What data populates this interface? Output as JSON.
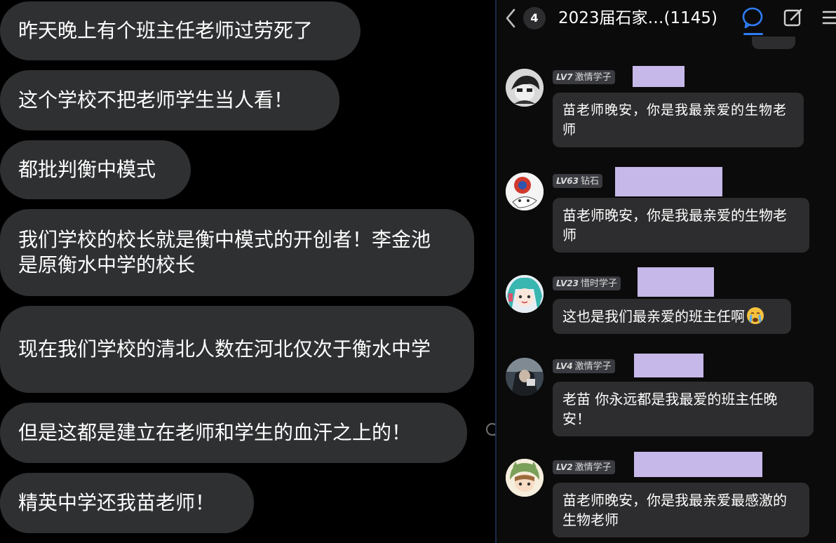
{
  "left_chat": {
    "messages": [
      {
        "text": "昨天晚上有个班主任老师过劳死了"
      },
      {
        "text": "这个学校不把老师学生当人看！"
      },
      {
        "text": "都批判衡中模式"
      },
      {
        "text": "我们学校的校长就是衡中模式的开创者！李金池是原衡水中学的校长"
      },
      {
        "text": "现在我们学校的清北人数在河北仅次于衡水中学"
      },
      {
        "text": "但是这都是建立在老师和学生的血汗之上的！"
      },
      {
        "text": "精英中学还我苗老师！"
      }
    ]
  },
  "right_chat": {
    "header": {
      "unread_count": "4",
      "group_title": "2023届石家…(1145)",
      "icons": [
        "back-chevron-icon",
        "chat-bubble-icon",
        "edit-icon",
        "menu-icon"
      ],
      "accent_color": "#2f7cf6"
    },
    "messages": [
      {
        "level": "LV7",
        "title": "激情学子",
        "text": "苗老师晚安，你是我最亲爱的生物老师"
      },
      {
        "level": "LV63",
        "title": "钻石",
        "text": "苗老师晚安，你是我最亲爱的生物老师"
      },
      {
        "level": "LV23",
        "title": "惜时学子",
        "text": "这也是我们最亲爱的班主任啊"
      },
      {
        "level": "LV4",
        "title": "激情学子",
        "text": "老苗 你永远都是我最爱的班主任晚安！"
      },
      {
        "level": "LV2",
        "title": "激情学子",
        "text": "苗老师晚安，你是我最亲爱最感激的生物老师"
      }
    ],
    "name_mask_color": "#c7b8ea"
  }
}
